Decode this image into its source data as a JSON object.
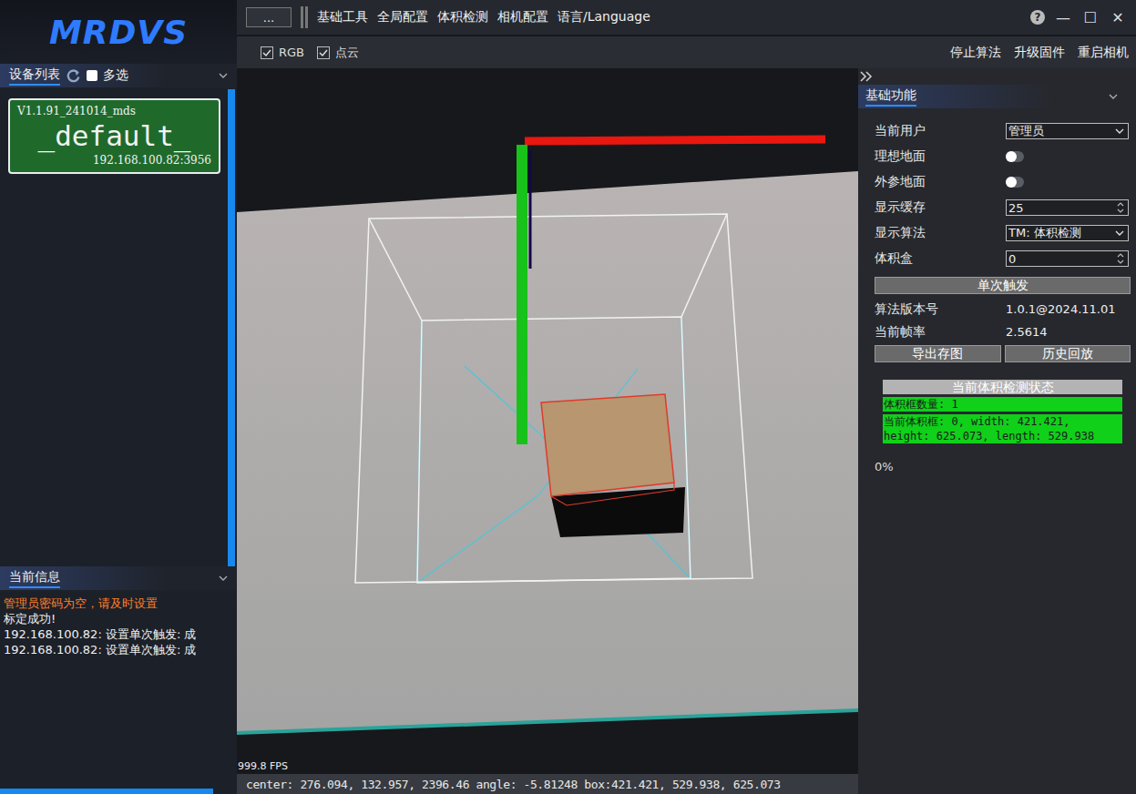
{
  "logo": "MRDVS",
  "device_list": {
    "title": "设备列表",
    "expanded": true,
    "multi_select": {
      "label": "多选",
      "checked": false
    },
    "devices": [
      {
        "version": "V1.1.91_241014_mds",
        "name": "_default_",
        "address": "192.168.100.82:3956",
        "selected": true
      }
    ],
    "scroll": {
      "level": 1
    }
  },
  "info_panel": {
    "title": "当前信息",
    "expanded": true,
    "messages": [
      {
        "text": "管理员密码为空，请及时设置",
        "kind": "warning"
      },
      {
        "text": "标定成功!",
        "kind": "normal"
      },
      {
        "text": "192.168.100.82: 设置单次触发: 成",
        "kind": "normal"
      },
      {
        "text": "192.168.100.82: 设置单次触发: 成",
        "kind": "normal"
      }
    ],
    "scroll": {
      "level": 0.9
    }
  },
  "toolbar": {
    "more_button": "...",
    "menus": [
      "基础工具",
      "全局配置",
      "体积检测",
      "相机配置",
      "语言/Language"
    ],
    "window_buttons": [
      "?",
      "—",
      "☐",
      "✕"
    ]
  },
  "view_bar": {
    "checkboxes": [
      {
        "label": "RGB",
        "checked": true
      },
      {
        "label": "点云",
        "checked": true
      }
    ],
    "actions": [
      "停止算法",
      "升级固件",
      "重启相机"
    ]
  },
  "viewport": {
    "fps": "999.8 FPS"
  },
  "status_bar": {
    "text": "center: 276.094, 132.957, 2396.46 angle: -5.81248 box:421.421, 529.938, 625.073"
  },
  "panel": {
    "title": "基础功能",
    "expanded": true,
    "fields": [
      {
        "kind": "select",
        "label": "当前用户",
        "value": "管理员"
      },
      {
        "kind": "toggle",
        "label": "理想地面",
        "on": false
      },
      {
        "kind": "toggle",
        "label": "外参地面",
        "on": false
      },
      {
        "kind": "spin",
        "label": "显示缓存",
        "value": "25"
      },
      {
        "kind": "select",
        "label": "显示算法",
        "value": "TM: 体积检测"
      },
      {
        "kind": "spin",
        "label": "体积盒",
        "value": "0"
      }
    ],
    "trigger_button": "单次触发",
    "info": [
      {
        "label": "算法版本号",
        "value": "1.0.1@2024.11.01"
      },
      {
        "label": "当前帧率",
        "value": "2.5614"
      }
    ],
    "buttons": [
      "导出存图",
      "历史回放"
    ],
    "status": {
      "title": "当前体积检测状态",
      "lines": [
        "体积框数量: 1",
        "当前体积框: 0, width: 421.421, height: 625.073, length: 529.938"
      ]
    },
    "progress": "0%"
  }
}
